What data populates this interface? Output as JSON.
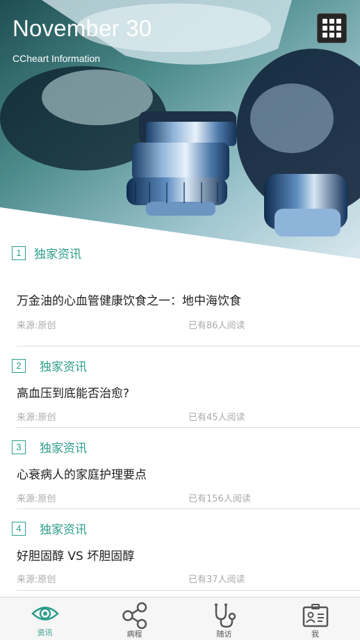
{
  "hero": {
    "date": "November 30",
    "subtitle": "CCheart Information"
  },
  "articles": [
    {
      "num": "1",
      "tag": "独家资讯",
      "title": "万金油的心血管健康饮食之一：地中海饮食",
      "source": "来源:原创",
      "reads": "已有86人阅读"
    },
    {
      "num": "2",
      "tag": "独家资讯",
      "title": "高血压到底能否治愈?",
      "source": "来源:原创",
      "reads": "已有45人阅读"
    },
    {
      "num": "3",
      "tag": "独家资讯",
      "title": "心衰病人的家庭护理要点",
      "source": "来源:原创",
      "reads": "已有156人阅读"
    },
    {
      "num": "4",
      "tag": "独家资讯",
      "title": "好胆固醇 VS 坏胆固醇",
      "source": "来源:原创",
      "reads": "已有37人阅读"
    }
  ],
  "tabbar": {
    "tabs": [
      {
        "label": "资讯",
        "icon": "eye-icon",
        "active": true
      },
      {
        "label": "病程",
        "icon": "share-nodes-icon",
        "active": false
      },
      {
        "label": "随访",
        "icon": "stethoscope-icon",
        "active": false
      },
      {
        "label": "我",
        "icon": "id-card-icon",
        "active": false
      }
    ]
  },
  "colors": {
    "accent": "#2a9d8a",
    "muted": "#aaaaaa",
    "tabbar_bg": "#f6f6f6"
  }
}
